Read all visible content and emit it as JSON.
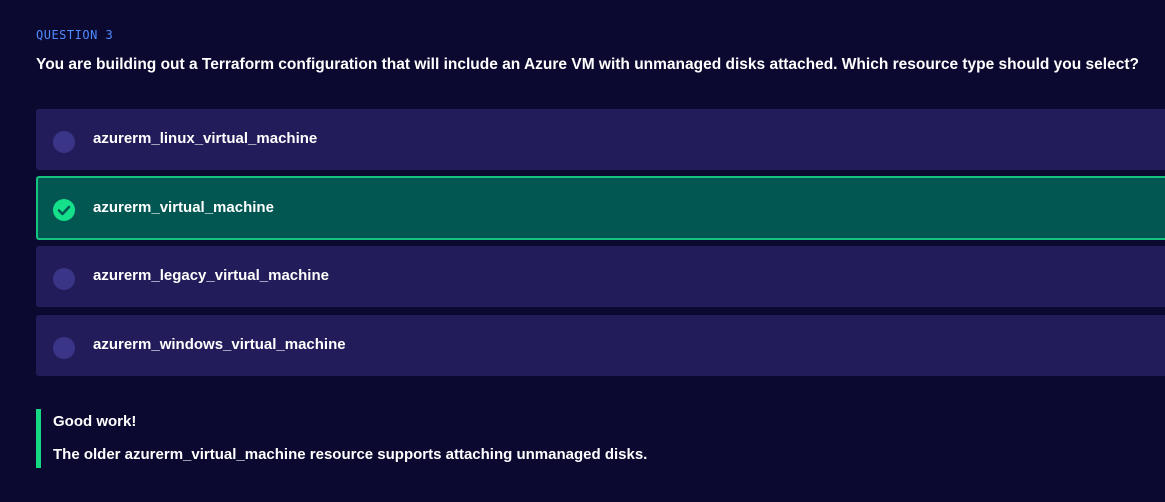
{
  "question": {
    "label": "QUESTION 3",
    "text": "You are building out a Terraform configuration that will include an Azure VM with unmanaged disks attached. Which resource type should you select?"
  },
  "options": [
    {
      "label": "azurerm_linux_virtual_machine",
      "selected": false
    },
    {
      "label": "azurerm_virtual_machine",
      "selected": true
    },
    {
      "label": "azurerm_legacy_virtual_machine",
      "selected": false
    },
    {
      "label": "azurerm_windows_virtual_machine",
      "selected": false
    }
  ],
  "feedback": {
    "title": "Good work!",
    "text": "The older azurerm_virtual_machine resource supports attaching unmanaged disks."
  },
  "colors": {
    "background": "#0b0930",
    "option_bg": "#221d5a",
    "selected_bg": "#035753",
    "accent_green": "#14c47e",
    "label_blue": "#4f8bff"
  },
  "icons": {
    "selected": "check-circle-icon",
    "unselected": "radio-circle-icon"
  }
}
